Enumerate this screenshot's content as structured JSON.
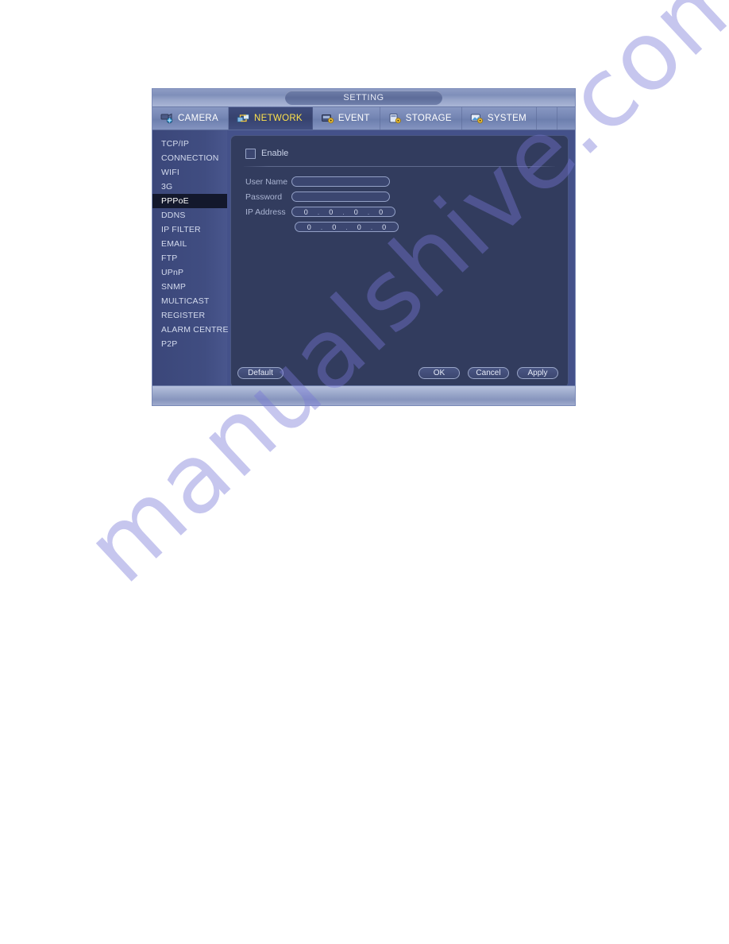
{
  "window": {
    "title": "SETTING"
  },
  "tabs": [
    {
      "label": "CAMERA",
      "icon": "camera-icon",
      "active": false
    },
    {
      "label": "NETWORK",
      "icon": "network-icon",
      "active": true
    },
    {
      "label": "EVENT",
      "icon": "event-icon",
      "active": false
    },
    {
      "label": "STORAGE",
      "icon": "storage-icon",
      "active": false
    },
    {
      "label": "SYSTEM",
      "icon": "system-icon",
      "active": false
    }
  ],
  "sidebar": {
    "items": [
      {
        "label": "TCP/IP",
        "selected": false
      },
      {
        "label": "CONNECTION",
        "selected": false
      },
      {
        "label": "WIFI",
        "selected": false
      },
      {
        "label": "3G",
        "selected": false
      },
      {
        "label": "PPPoE",
        "selected": true
      },
      {
        "label": "DDNS",
        "selected": false
      },
      {
        "label": "IP FILTER",
        "selected": false
      },
      {
        "label": "EMAIL",
        "selected": false
      },
      {
        "label": "FTP",
        "selected": false
      },
      {
        "label": "UPnP",
        "selected": false
      },
      {
        "label": "SNMP",
        "selected": false
      },
      {
        "label": "MULTICAST",
        "selected": false
      },
      {
        "label": "REGISTER",
        "selected": false
      },
      {
        "label": "ALARM CENTRE",
        "selected": false
      },
      {
        "label": "P2P",
        "selected": false
      }
    ]
  },
  "form": {
    "enable": {
      "label": "Enable",
      "checked": false
    },
    "username": {
      "label": "User Name",
      "value": "",
      "placeholder": ""
    },
    "password": {
      "label": "Password",
      "value": "",
      "placeholder": ""
    },
    "ip_address": {
      "label": "IP Address",
      "row1": [
        "0",
        "0",
        "0",
        "0"
      ],
      "row2": [
        "0",
        "0",
        "0",
        "0"
      ],
      "separator": "."
    }
  },
  "footer": {
    "default_label": "Default",
    "ok_label": "OK",
    "cancel_label": "Cancel",
    "apply_label": "Apply"
  },
  "watermark": {
    "text": "manualshive.com"
  },
  "colors": {
    "accent_active_tab_text": "#ffe34d",
    "panel_bg": "#323c5e",
    "sidebar_selected_bg": "#13182c",
    "dialog_bg": "#46538a",
    "bottom_strip": "#9aa7ca"
  }
}
